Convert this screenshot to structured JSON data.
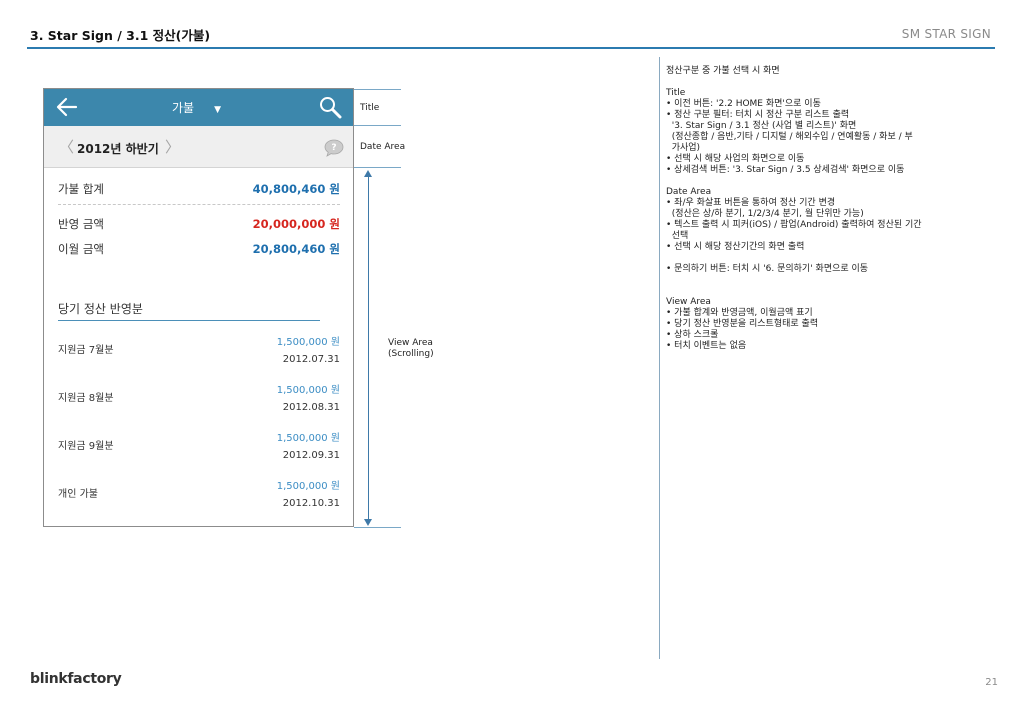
{
  "slide": {
    "title": "3. Star Sign / 3.1 정산(가불)",
    "brand_right": "SM STAR SIGN",
    "footer_logo": "blinkfactory",
    "page_number": "21"
  },
  "phone": {
    "title_bar": {
      "title": "가불",
      "caret": "▼",
      "color": "#3c87ac"
    },
    "date_area": {
      "prev": "〈",
      "label": "2012년 하반기",
      "next": "〉"
    },
    "summary": {
      "total_label": "가불 합계",
      "total_amount": "40,800,460 원",
      "reflect_label": "반영 금액",
      "reflect_amount": "20,000,000 원",
      "carry_label": "이월 금액",
      "carry_amount": "20,800,460 원"
    },
    "section_title": "당기 정산 반영분",
    "list": [
      {
        "label": "지원금 7월분",
        "amount": "1,500,000 원",
        "date": "2012.07.31"
      },
      {
        "label": "지원금 8월분",
        "amount": "1,500,000 원",
        "date": "2012.08.31"
      },
      {
        "label": "지원금 9월분",
        "amount": "1,500,000 원",
        "date": "2012.09.31"
      },
      {
        "label": "개인 가불",
        "amount": "1,500,000 원",
        "date": "2012.10.31"
      }
    ]
  },
  "annotations": {
    "title": "Title",
    "date_area": "Date Area",
    "view_area_line1": "View Area",
    "view_area_line2": "(Scrolling)"
  },
  "description": {
    "intro": "정산구분 중 가불 선택 시 화면",
    "title_section": [
      "Title",
      "• 이전 버튼: '2.2 HOME 화면'으로 이동",
      "• 정산 구분 필터: 터치 시 정산 구분 리스트 출력",
      "  '3. Star Sign / 3.1 정산 (사업 별 리스트)' 화면",
      "  (정산종합 / 음반,기타 / 디지털 / 해외수입 / 연예활동 / 화보 / 부",
      "  가사업)",
      "• 선택 시 해당 사업의 화면으로 이동",
      "• 상세검색 버튼: '3. Star Sign / 3.5 상세검색' 화면으로 이동"
    ],
    "date_section": [
      "Date Area",
      "• 좌/우 화살표 버튼을 통하여 정산 기간 변경",
      "  (정산은 상/하 분기, 1/2/3/4 분기, 월 단위만 가능)",
      "• 텍스트 출력 시 피커(iOS) / 팝업(Android) 출력하여 정산된 기간",
      "  선택",
      "• 선택 시 해당 정산기간의 화면 출력"
    ],
    "inquiry_line": "• 문의하기 버튼: 터치 시 '6. 문의하기' 화면으로 이동",
    "view_section": [
      "View Area",
      "• 가불 합계와 반영금액, 이월금액 표기",
      "• 당기 정산 반영분을 리스트형태로 출력",
      "• 상하 스크롤",
      "• 터치 이벤트는 없음"
    ]
  }
}
